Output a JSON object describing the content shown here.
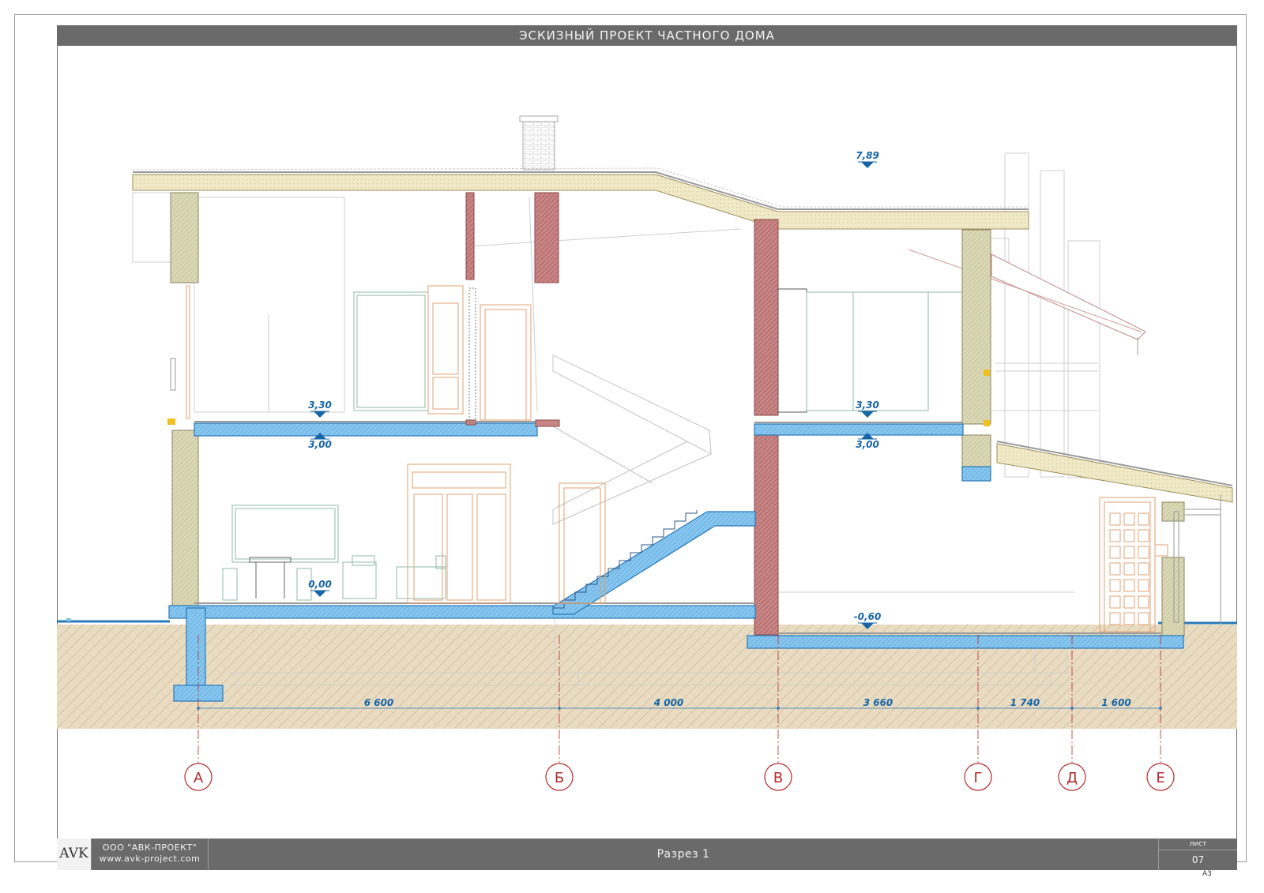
{
  "header": {
    "title": "ЭСКИЗНЫЙ ПРОЕКТ ЧАСТНОГО ДОМА"
  },
  "footer": {
    "logo": "AVK",
    "company": "ООО \"АВК-ПРОЕКТ\"",
    "website": "www.avk-project.com",
    "sheet_title": "Разрез 1",
    "sheet_label": "лист",
    "sheet_number": "07",
    "paper_format": "А3"
  },
  "levels": {
    "roof_top": "7,89",
    "floor2_left": "3,30",
    "ceiling1_left": "3,00",
    "floor2_right": "3,30",
    "ceiling1_right": "3,00",
    "floor1": "0,00",
    "basement": "-0,60"
  },
  "dimensions": [
    "6 600",
    "4 000",
    "3 660",
    "1 740",
    "1 600"
  ],
  "axes": [
    "А",
    "Б",
    "В",
    "Г",
    "Д",
    "Е"
  ],
  "colors": {
    "concrete": "#7ec1ec",
    "concrete_stroke": "#2a78b8",
    "brick": "#c97b7b",
    "insulation": "#e3e0c2",
    "ground": "#e8d8bd",
    "axis_red": "#b52a2a",
    "level_blue": "#1565a8",
    "interior_orange": "#e0a070",
    "interior_green": "#8fb9a8"
  }
}
